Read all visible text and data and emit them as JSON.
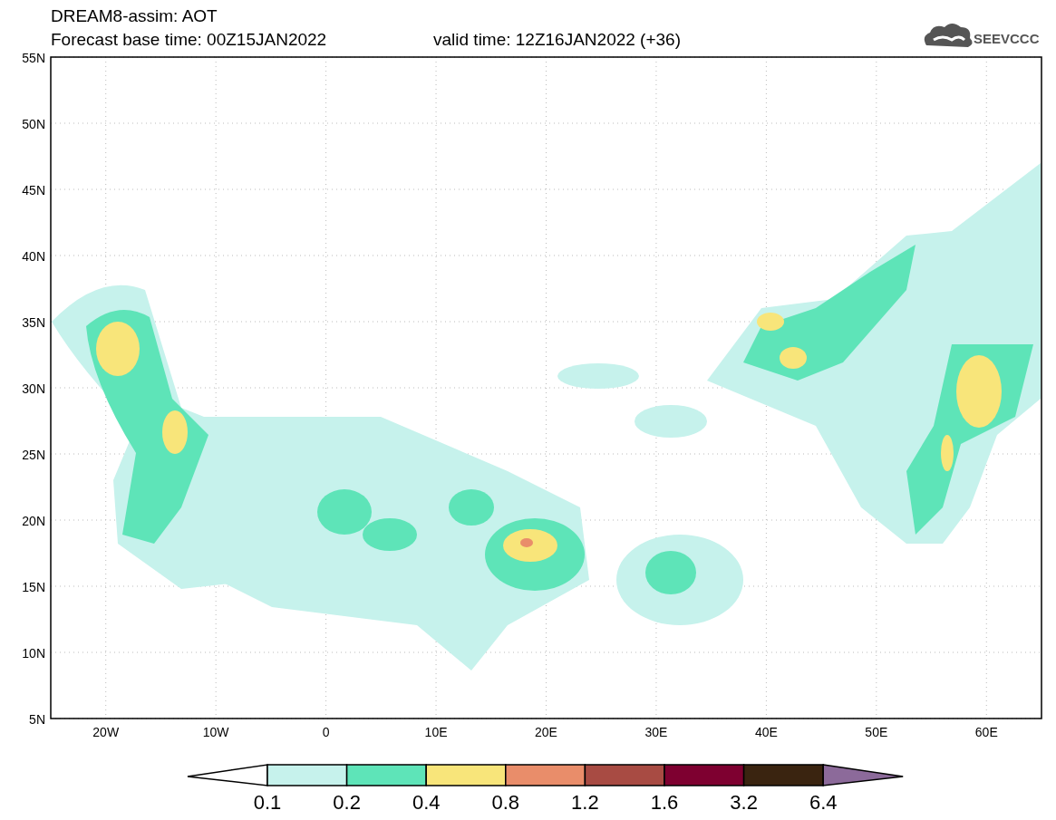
{
  "header": {
    "product": "DREAM8-assim: AOT",
    "base_time": "Forecast base time: 00Z15JAN2022",
    "valid_time": "valid time: 12Z16JAN2022 (+36)",
    "logo_text": "SEEVCCC"
  },
  "map": {
    "lat_labels": [
      "55N",
      "50N",
      "45N",
      "40N",
      "35N",
      "30N",
      "25N",
      "20N",
      "15N",
      "10N",
      "5N"
    ],
    "lon_labels": [
      "20W",
      "10W",
      "0",
      "10E",
      "20E",
      "30E",
      "40E",
      "50E",
      "60E"
    ]
  },
  "legend": {
    "bins": [
      {
        "kind": "under",
        "color": "#ffffff"
      },
      {
        "kind": "box",
        "color": "#c6f2ec"
      },
      {
        "kind": "box",
        "color": "#5ee4b8"
      },
      {
        "kind": "box",
        "color": "#f8e57a"
      },
      {
        "kind": "box",
        "color": "#e98d6a"
      },
      {
        "kind": "box",
        "color": "#a84b43"
      },
      {
        "kind": "box",
        "color": "#7e0030"
      },
      {
        "kind": "box",
        "color": "#3a2410"
      },
      {
        "kind": "over",
        "color": "#8c6a9a"
      }
    ],
    "labels": [
      "0.1",
      "0.2",
      "0.4",
      "0.8",
      "1.2",
      "1.6",
      "3.2",
      "6.4"
    ]
  }
}
